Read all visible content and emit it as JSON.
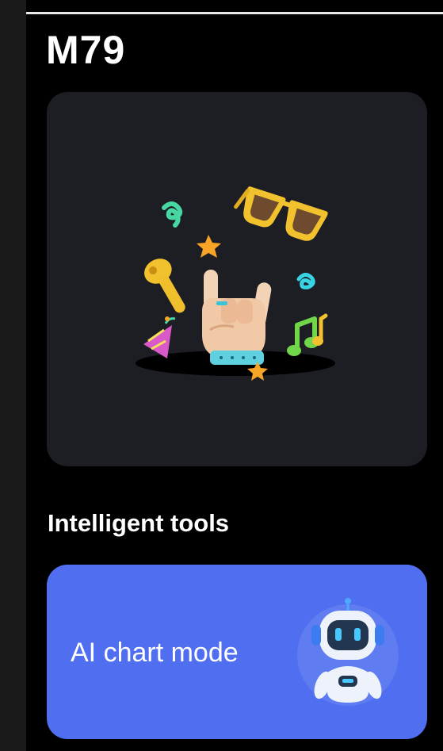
{
  "header": {
    "device_name": "M79"
  },
  "hero": {
    "illustration": "rock-hand-celebration-illustration",
    "icons": [
      "sunglasses-icon",
      "earbud-icon",
      "music-notes-icon",
      "party-popper-icon",
      "star-icon",
      "rock-hand-icon"
    ]
  },
  "tools": {
    "heading": "Intelligent tools",
    "items": [
      {
        "label": "AI chart mode",
        "icon": "robot-icon"
      }
    ]
  },
  "colors": {
    "background": "#000000",
    "card": "#1c1e24",
    "tool_card": "#4f6ef0",
    "text": "#ffffff"
  }
}
